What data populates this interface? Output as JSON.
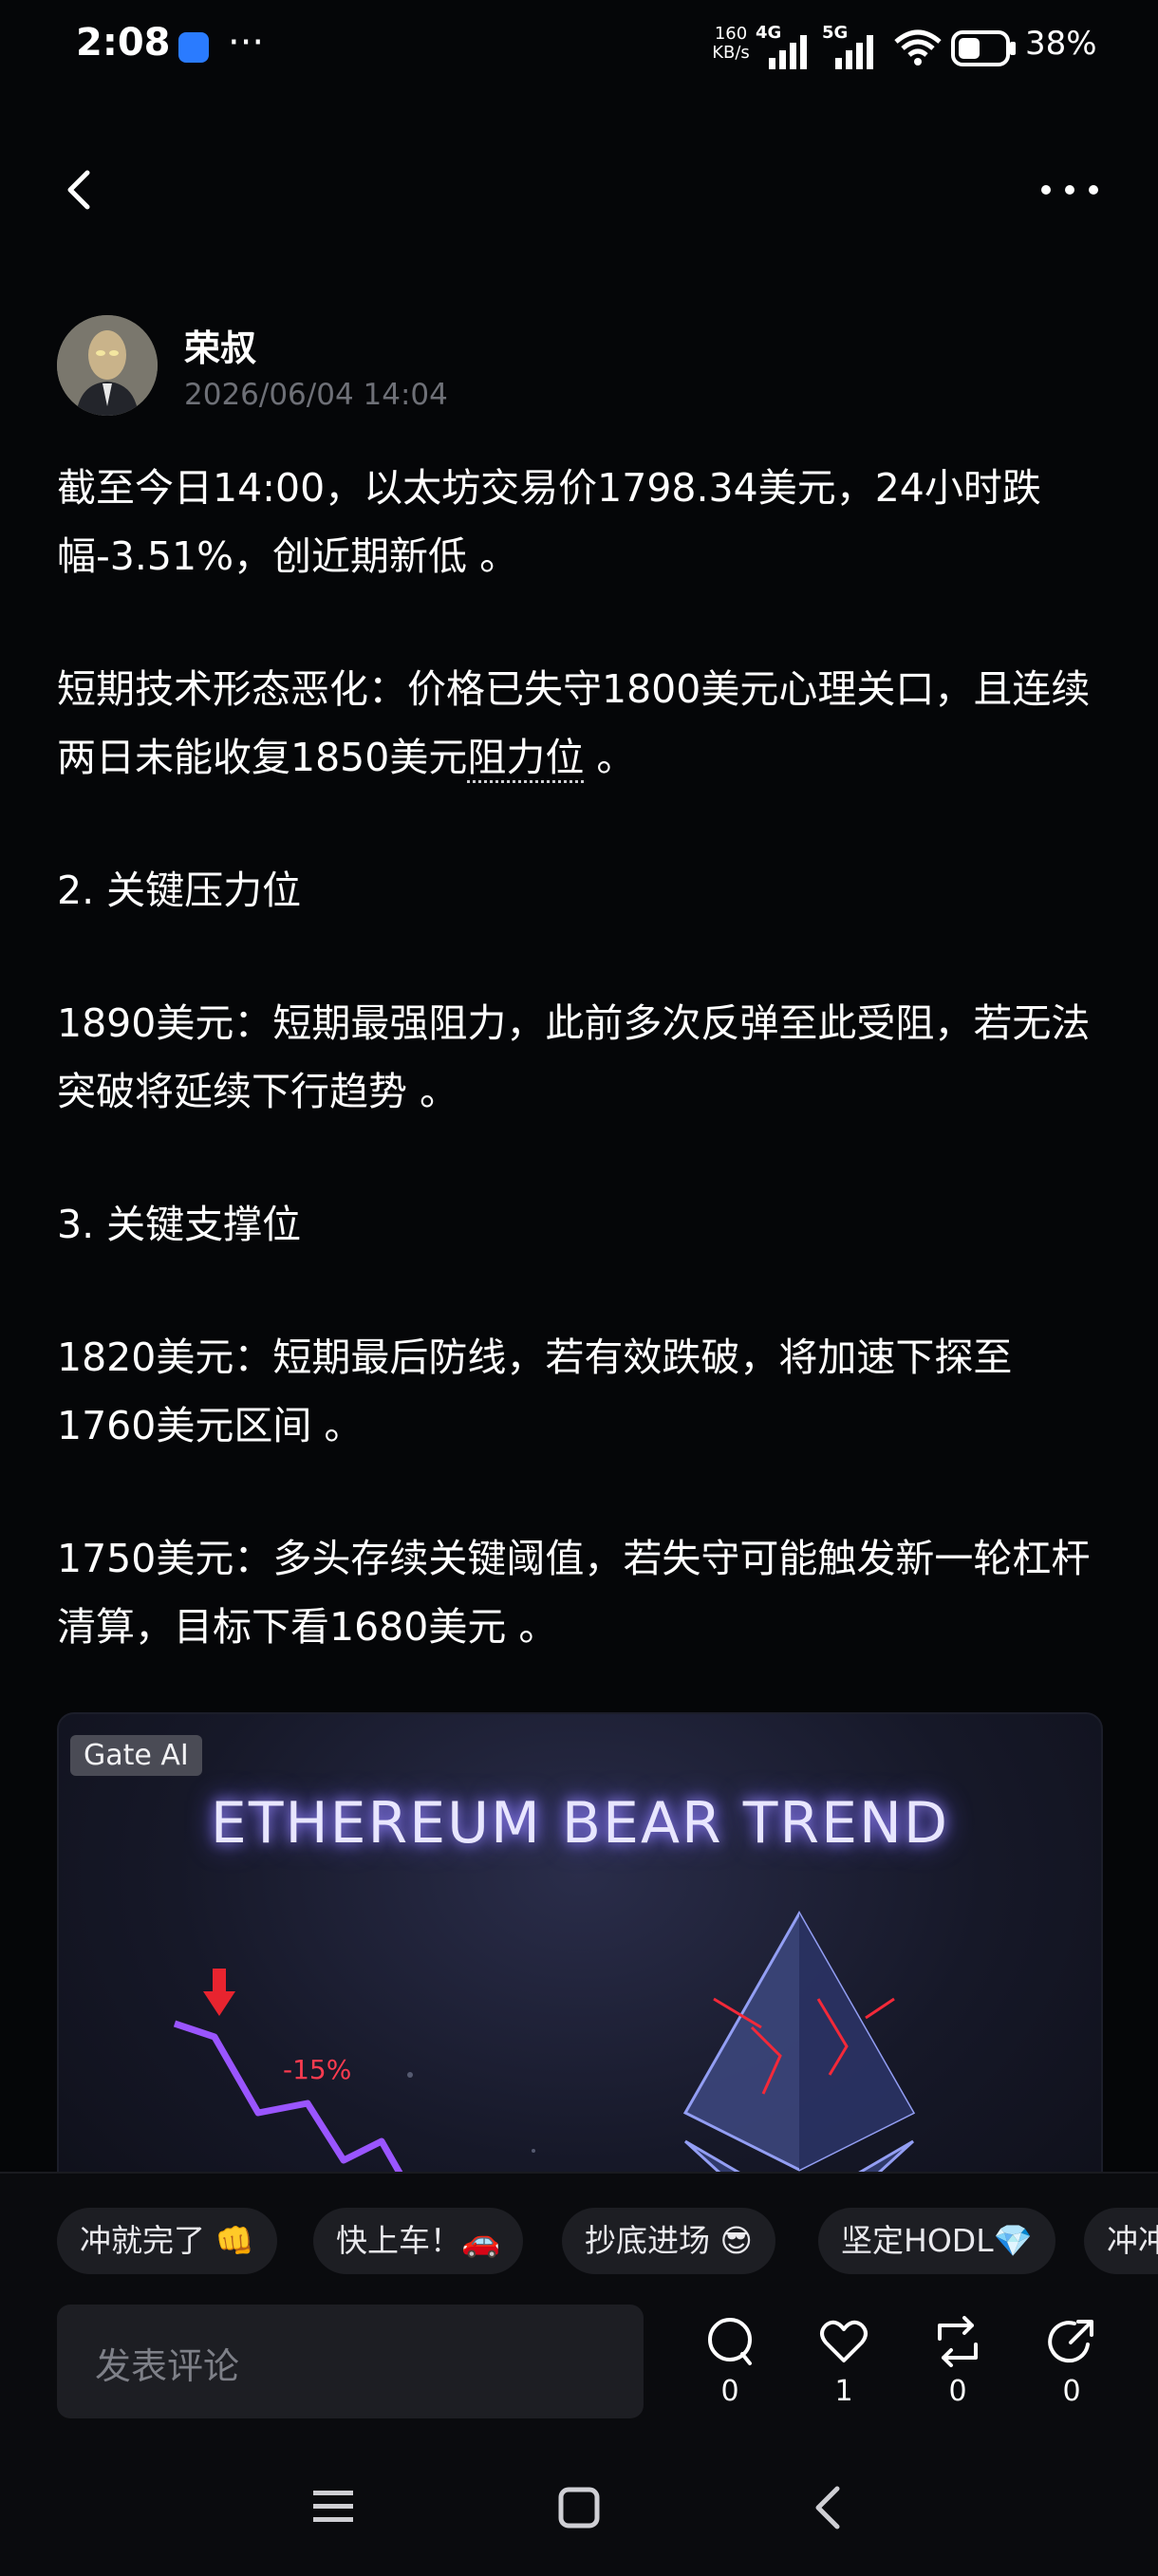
{
  "status_bar": {
    "time": "2:08",
    "notif_dots": "···",
    "net_speed_value": "160",
    "net_speed_unit": "KB/s",
    "signal_1": "4G",
    "signal_2": "5G",
    "battery": "38%"
  },
  "header": {
    "back_icon": "chevron-left-icon",
    "more_icon": "more-horizontal-icon"
  },
  "post": {
    "author": "荣叔",
    "timestamp": "2026/06/04 14:04",
    "paragraphs": {
      "p1": "截至今日14:00，以太坊交易价1798.34美元，24小时跌幅-3.51%，创近期新低 。",
      "p2_pre": "短期技术形态恶化：价格已失守1800美元心理关口，且连续两日未能收复1850美元",
      "p2_link": "阻力位",
      "p2_post": " 。",
      "p3": "2. 关键压力位",
      "p4": "1890美元：短期最强阻力，此前多次反弹至此受阻，若无法突破将延续下行趋势 。",
      "p5": "3. 关键支撑位",
      "p6": "1820美元：短期最后防线，若有效跌破，将加速下探至1760美元区间 。",
      "p7": "1750美元：多头存续关键阈值，若失守可能触发新一轮杠杆清算，目标下看1680美元 。"
    },
    "image": {
      "tag": "Gate AI",
      "title": "ETHEREUM BEAR TREND",
      "pct_label": "-15%"
    }
  },
  "quick_reactions": [
    "冲就完了 👊",
    "快上车！🚗",
    "抄底进场 😎",
    "坚定HODL💎",
    "冲冲"
  ],
  "comment": {
    "placeholder": "发表评论"
  },
  "actions": {
    "comment_count": "0",
    "like_count": "1",
    "repost_count": "0",
    "share_count": "0"
  },
  "colors": {
    "background": "#050608",
    "accent_purple": "#8a4dff",
    "alert_red": "#ff3b4f"
  }
}
